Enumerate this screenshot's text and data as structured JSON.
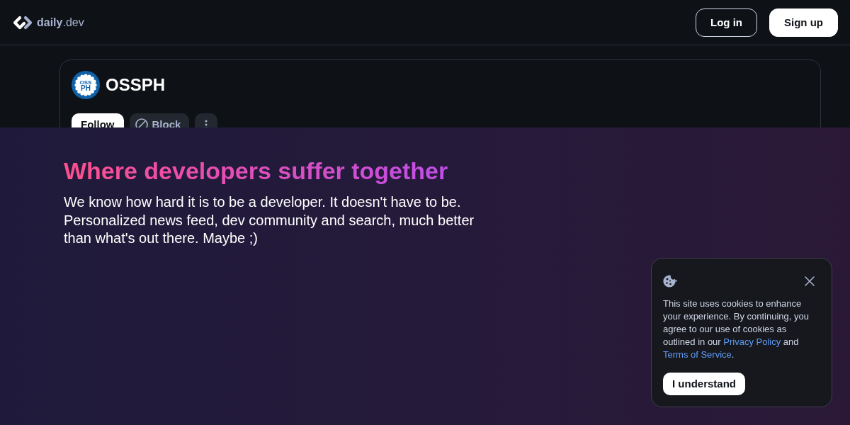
{
  "header": {
    "logo": "**daily**.dev",
    "buttons": [
      {
        "kind": "outline",
        "label": "Log in"
      },
      {
        "kind": "solid",
        "label": "Sign up"
      }
    ]
  },
  "source": {
    "avatar_text": [
      "OSS",
      "PH"
    ],
    "name": "OSSPH",
    "actions": [
      {
        "kind": "follow",
        "label": "Follow"
      },
      {
        "kind": "block",
        "label": "Block"
      },
      {
        "kind": "menu"
      }
    ]
  },
  "promo": {
    "title": "Where developers suffer together",
    "text": "We know how hard it is to be a developer. It doesn't have to be. Personalized news feed, dev community and search, much better than what's out there. Maybe ;)"
  },
  "cookie_banner": {
    "message": [
      {
        "kind": "text",
        "text": "This site uses cookies to enhance your experience. By continuing, you agree to our use of cookies as outlined in our "
      },
      {
        "kind": "link",
        "text": "Privacy Policy"
      },
      {
        "kind": "text",
        "text": " and "
      },
      {
        "kind": "link",
        "text": "Terms of Service"
      },
      {
        "kind": "text",
        "text": "."
      }
    ],
    "button": "I understand"
  }
}
